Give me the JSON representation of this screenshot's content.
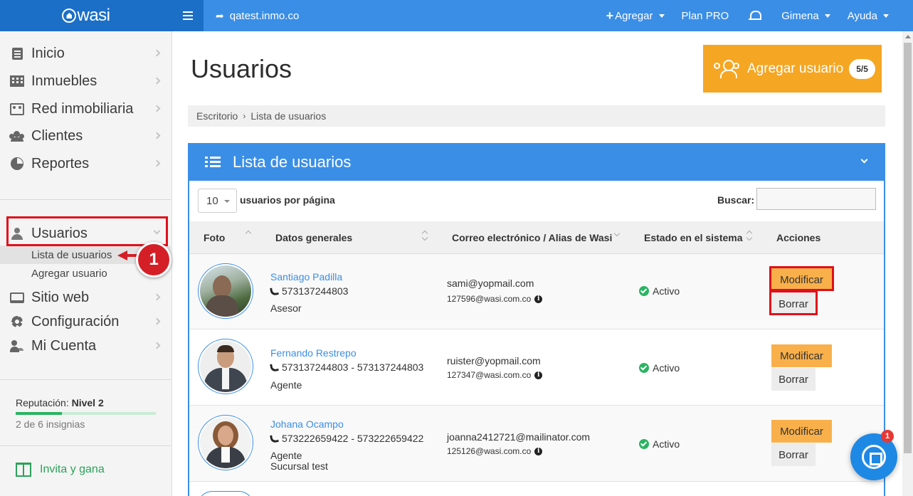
{
  "topbar": {
    "logo": "wasi",
    "site": "qatest.inmo.co",
    "add": "Agregar",
    "plan": "Plan PRO",
    "user": "Gimena",
    "help": "Ayuda"
  },
  "sidebar": {
    "items": [
      {
        "label": "Inicio",
        "icon": "document-icon"
      },
      {
        "label": "Inmuebles",
        "icon": "building-icon"
      },
      {
        "label": "Red inmobiliaria",
        "icon": "network-icon"
      },
      {
        "label": "Clientes",
        "icon": "users-icon"
      },
      {
        "label": "Reportes",
        "icon": "pie-chart-icon"
      }
    ],
    "usuarios": "Usuarios",
    "sub": [
      "Lista de usuarios",
      "Agregar usuario"
    ],
    "items2": [
      {
        "label": "Sitio web",
        "icon": "monitor-icon"
      },
      {
        "label": "Configuración",
        "icon": "gear-icon"
      },
      {
        "label": "Mi Cuenta",
        "icon": "user-cog-icon"
      }
    ],
    "reputation_label": "Reputación:",
    "reputation_level": "Nivel 2",
    "reputation_progress": 0.33,
    "badges": "2 de 6 insignias",
    "invite": "Invita y gana"
  },
  "callout": "1",
  "main": {
    "title": "Usuarios",
    "add_button": "Agregar usuario",
    "add_badge": "5/5",
    "breadcrumb": [
      "Escritorio",
      "Lista de usuarios"
    ],
    "panel_title": "Lista de usuarios",
    "page_size": "10",
    "per_page": "usuarios por página",
    "search_label": "Buscar:",
    "search_value": "",
    "columns": [
      "Foto",
      "Datos generales",
      "Correo electrónico / Alias de Wasi",
      "Estado en el sistema",
      "Acciones"
    ],
    "rows": [
      {
        "name": "Santiago Padilla",
        "phone": "573137244803",
        "role": "Asesor",
        "extra": "",
        "email": "sami@yopmail.com",
        "alias": "127596@wasi.com.co",
        "status": "Activo",
        "edit": "Modificar",
        "delete": "Borrar"
      },
      {
        "name": "Fernando Restrepo",
        "phone": "573137244803 - 573137244803",
        "role": "Agente",
        "extra": "",
        "email": "ruister@yopmail.com",
        "alias": "127347@wasi.com.co",
        "status": "Activo",
        "edit": "Modificar",
        "delete": "Borrar"
      },
      {
        "name": "Johana Ocampo",
        "phone": "573222659422 - 573222659422",
        "role": "Agente",
        "extra": "Sucursal test",
        "email": "joanna2412721@mailinator.com",
        "alias": "125126@wasi.com.co",
        "status": "Activo",
        "edit": "Modificar",
        "delete": "Borrar"
      }
    ]
  },
  "chat_badge": "1",
  "colors": {
    "primary": "#3a8ee6",
    "accent": "#f5a623",
    "success": "#2bb463",
    "highlight": "#e0101a"
  }
}
